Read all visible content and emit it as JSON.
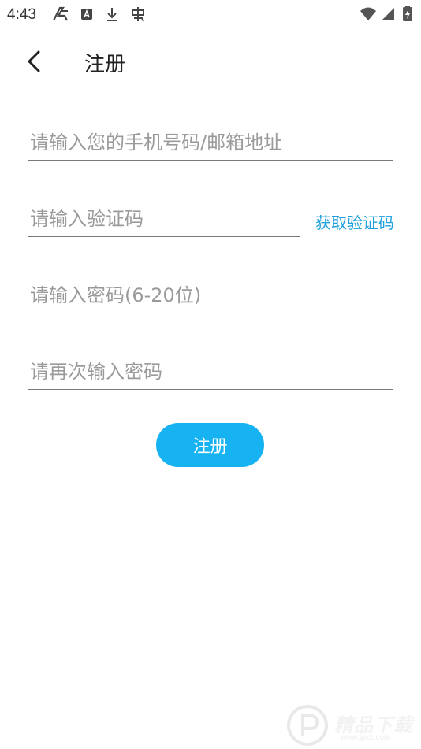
{
  "status_bar": {
    "time": "4:43",
    "left_icons": [
      "signal-app-icon",
      "a-box-icon",
      "download-icon",
      "bug-icon"
    ],
    "right_icons": [
      "wifi-icon",
      "cell-signal-icon",
      "battery-icon"
    ]
  },
  "header": {
    "title": "注册",
    "back_icon": "chevron-left-icon"
  },
  "form": {
    "account_placeholder": "请输入您的手机号码/邮箱地址",
    "code_placeholder": "请输入验证码",
    "get_code_label": "获取验证码",
    "password_placeholder": "请输入密码(6-20位)",
    "confirm_placeholder": "请再次输入密码",
    "submit_label": "注册"
  },
  "watermark": {
    "text": "精品下载",
    "url": "www.jpxz.com"
  },
  "colors": {
    "accent": "#17b2f2",
    "link": "#1ea0dc",
    "placeholder": "#9a9a9a",
    "underline": "#7a7a7a"
  }
}
